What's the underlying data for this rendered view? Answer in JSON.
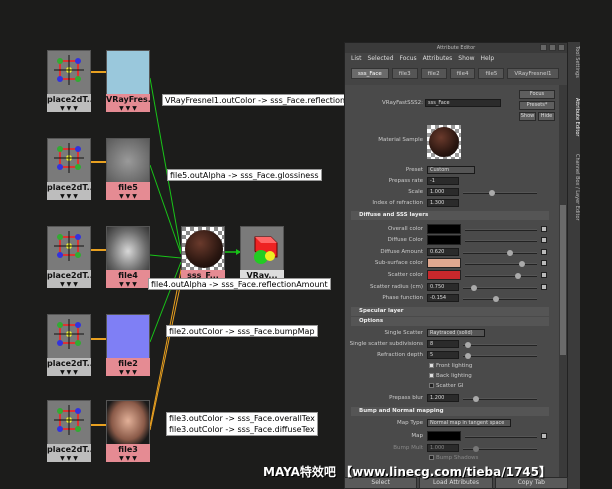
{
  "nodes": {
    "place2d": [
      "place2dT...",
      "place2dT...",
      "place2dT...",
      "place2dT...",
      "place2dT..."
    ],
    "tex": [
      "VRayFres...",
      "file5",
      "file4",
      "file2",
      "file3"
    ],
    "shader": "sss_F...",
    "sg": "VRay..."
  },
  "connections": [
    "VRayFresnel1.outColor -> sss_Face.reflection",
    "file5.outAlpha -> sss_Face.glossiness",
    "file4.outAlpha -> sss_Face.reflectionAmount",
    "file2.outColor -> sss_Face.bumpMap",
    "file3.outColor -> sss_Face.overallTex",
    "file3.outColor -> sss_Face.diffuseTex"
  ],
  "ae": {
    "title": "Attribute Editor",
    "menu": [
      "List",
      "Selected",
      "Focus",
      "Attributes",
      "Show",
      "Help"
    ],
    "tabs": [
      "sss_Face",
      "file3",
      "file2",
      "file4",
      "file5",
      "VRayFresnel1"
    ],
    "node_type_label": "VRayFastSSS2:",
    "node_name": "sss_Face",
    "focus": "Focus",
    "presets": "Presets*",
    "show": "Show",
    "hide": "Hide",
    "material_sample": "Material Sample",
    "preset_label": "Preset",
    "preset_value": "Custom",
    "rows_top": [
      {
        "label": "Prepass rate",
        "value": "-1"
      },
      {
        "label": "Scale",
        "value": "1.000"
      },
      {
        "label": "Index of refraction",
        "value": "1.300"
      }
    ],
    "section_diffuse": "Diffuse and SSS layers",
    "diffuse_rows": [
      {
        "label": "Overall color",
        "value": ""
      },
      {
        "label": "Diffuse Color",
        "value": ""
      },
      {
        "label": "Diffuse Amount",
        "value": "0.620"
      },
      {
        "label": "Sub-surface color",
        "value": ""
      },
      {
        "label": "Scatter color",
        "value": ""
      },
      {
        "label": "Scatter radius (cm)",
        "value": "0.750"
      },
      {
        "label": "Phase function",
        "value": "-0.154"
      }
    ],
    "section_specular": "Specular layer",
    "section_options": "Options",
    "single_scatter_label": "Single Scatter",
    "single_scatter_value": "Raytraced (solid)",
    "subdiv_label": "Single scatter subdivisions",
    "subdiv_value": "8",
    "refr_label": "Refraction depth",
    "refr_value": "5",
    "checks": [
      "Front lighting",
      "Back lighting",
      "Scatter GI"
    ],
    "prepass_blur_label": "Prepass blur",
    "prepass_blur_value": "1.200",
    "section_bump": "Bump and Normal mapping",
    "map_type_label": "Map Type",
    "map_type_value": "Normal map in tangent space",
    "map_label": "Map",
    "bump_mult_label": "Bump Mult",
    "bump_mult_value": "1.000",
    "bump_shadows": "Bump Shadows",
    "bottom_buttons": [
      "Select",
      "Load Attributes",
      "Copy Tab"
    ]
  },
  "side_tabs": [
    "Tool Settings",
    "Attribute Editor",
    "Channel Box / Layer Editor"
  ],
  "watermark": "MAYA特效吧 【www.linecg.com/tieba/1745】",
  "colors": {
    "texture_label_bg": "#e58b93",
    "place2d_label_bg": "#bdbdbd",
    "connection_green": "#18c418",
    "connection_orange": "#e8a020",
    "subsurface_color": "#e0a890",
    "scatter_color": "#c8282c"
  }
}
